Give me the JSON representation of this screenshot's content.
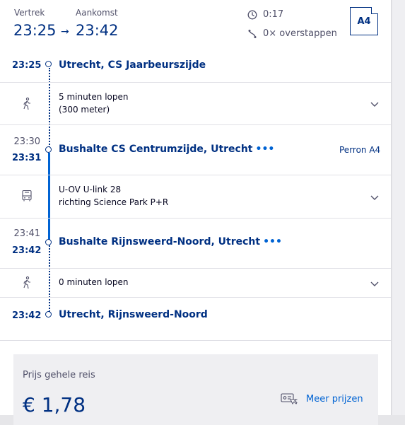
{
  "header": {
    "departure_label": "Vertrek",
    "arrival_label": "Aankomst",
    "departure_time": "23:25",
    "arrival_time": "23:42",
    "duration": "0:17",
    "transfers": "0× overstappen",
    "platform_badge": "A4"
  },
  "legs": [
    {
      "time_arr": "",
      "time_dep": "23:25",
      "station": "Utrecht, CS Jaarbeurszijde",
      "more": false,
      "platform": ""
    },
    {
      "time_arr": "23:30",
      "time_dep": "23:31",
      "station": "Bushalte CS Centrumzijde, Utrecht",
      "more": true,
      "platform": "Perron A4"
    },
    {
      "time_arr": "23:41",
      "time_dep": "23:42",
      "station": "Bushalte Rijnsweerd-Noord, Utrecht",
      "more": true,
      "platform": ""
    },
    {
      "time_arr": "",
      "time_dep": "23:42",
      "station": "Utrecht, Rijnsweerd-Noord",
      "more": false,
      "platform": ""
    }
  ],
  "segments": [
    {
      "icon": "walk-icon",
      "line1": "5 minuten lopen",
      "line2": "(300 meter)"
    },
    {
      "icon": "bus-icon",
      "line1": "U-OV U-link 28",
      "line2": "richting Science Park P+R"
    },
    {
      "icon": "walk-icon",
      "line1": "0 minuten lopen",
      "line2": ""
    }
  ],
  "more_glyph": "•••",
  "price": {
    "label": "Prijs gehele reis",
    "value": "€  1,78",
    "more_label": "Meer prijzen"
  },
  "colors": {
    "brand_blue": "#003082",
    "link_blue": "#0063d3",
    "text_grey": "#51516a",
    "panel_grey": "#efeff2"
  }
}
